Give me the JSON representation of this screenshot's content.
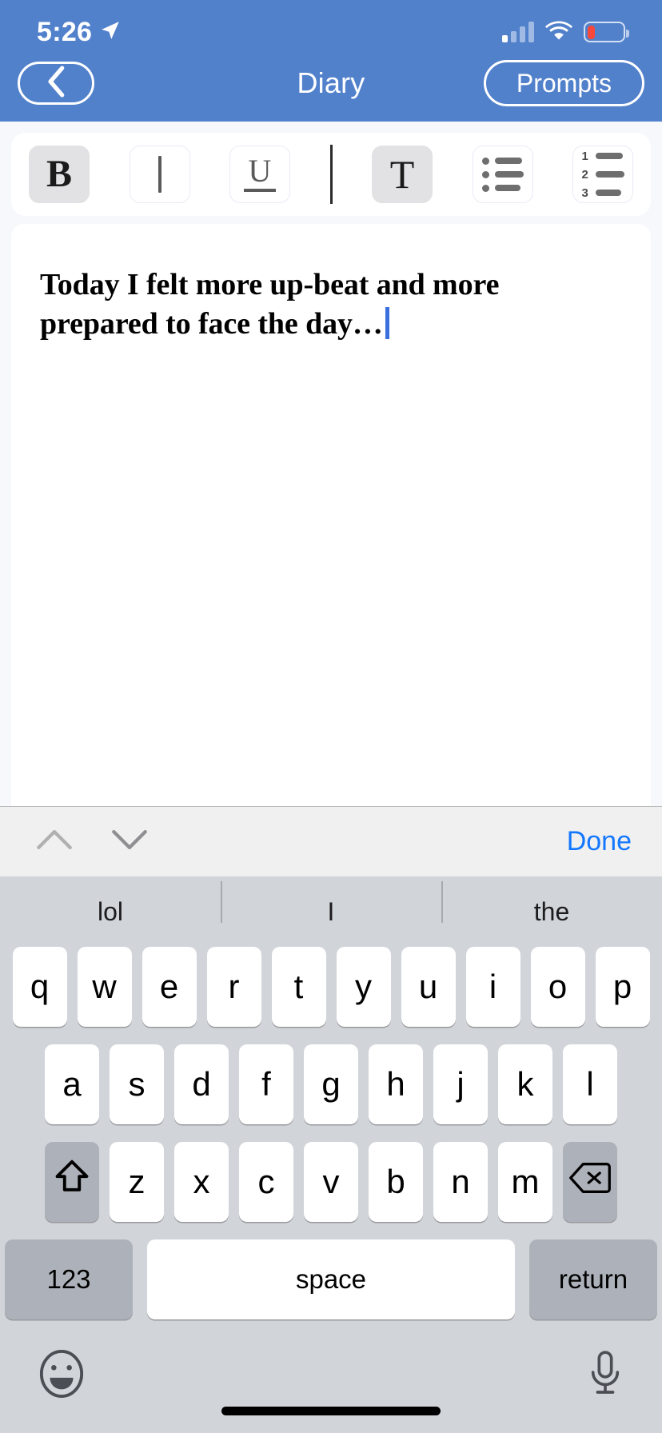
{
  "status_bar": {
    "time": "5:26",
    "location_icon": "location-arrow-icon",
    "signal_icon": "cellular-signal-icon",
    "signal_bars_filled": 1,
    "wifi_icon": "wifi-icon",
    "battery_icon": "battery-low-icon",
    "battery_percent": 22,
    "battery_color": "#f7483b"
  },
  "navbar": {
    "background_color": "#5281cc",
    "back_label": "back-chevron",
    "title": "Diary",
    "prompts_label": "Prompts"
  },
  "toolbar": {
    "buttons": [
      {
        "name": "bold",
        "glyph": "B",
        "active": true
      },
      {
        "name": "italic",
        "glyph": "I",
        "active": false
      },
      {
        "name": "underline",
        "glyph": "U",
        "active": false
      },
      {
        "name": "text-style",
        "glyph": "T",
        "active": true
      },
      {
        "name": "bulleted-list",
        "glyph": "bullet-list-icon",
        "active": false
      },
      {
        "name": "numbered-list",
        "glyph": "numbered-list-icon",
        "active": false
      }
    ],
    "numbered_list_labels": [
      "1",
      "2",
      "3"
    ]
  },
  "editor": {
    "text": "Today I felt more up-beat and more prepared to face the day…",
    "caret_visible": true,
    "caret_color": "#3b6fe0"
  },
  "accessory_bar": {
    "prev_icon": "chevron-up-icon",
    "next_icon": "chevron-down-icon",
    "done_label": "Done",
    "done_color": "#1377ff"
  },
  "keyboard": {
    "predictions": [
      "lol",
      "I",
      "the"
    ],
    "row1": [
      "q",
      "w",
      "e",
      "r",
      "t",
      "y",
      "u",
      "i",
      "o",
      "p"
    ],
    "row2": [
      "a",
      "s",
      "d",
      "f",
      "g",
      "h",
      "j",
      "k",
      "l"
    ],
    "row3": [
      "z",
      "x",
      "c",
      "v",
      "b",
      "n",
      "m"
    ],
    "shift_label": "shift-icon",
    "delete_label": "delete-icon",
    "numbers_label": "123",
    "space_label": "space",
    "return_label": "return",
    "emoji_label": "emoji-icon",
    "dictation_label": "microphone-icon"
  }
}
